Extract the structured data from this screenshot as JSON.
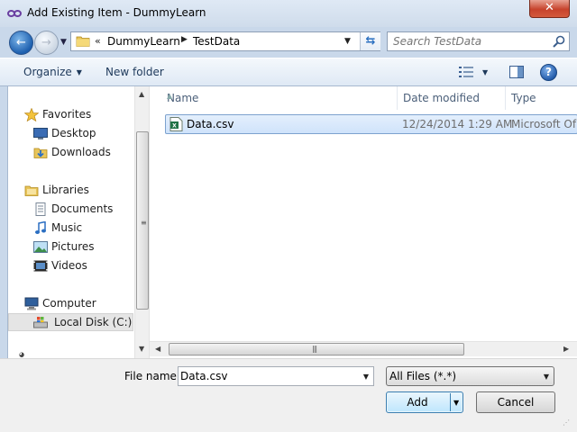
{
  "window": {
    "title": "Add Existing Item - DummyLearn",
    "close_glyph": "✕"
  },
  "navigation": {
    "back_glyph": "←",
    "forward_glyph": "→",
    "breadcrumb_overflow": "«",
    "breadcrumbs": [
      "DummyLearn",
      "TestData"
    ],
    "search_placeholder": "Search TestData"
  },
  "toolbar": {
    "organize_label": "Organize",
    "new_folder_label": "New folder",
    "help_glyph": "?"
  },
  "nav_pane": {
    "items": [
      {
        "label": "Favorites",
        "icon": "star-icon"
      },
      {
        "label": "Desktop",
        "icon": "desktop-icon"
      },
      {
        "label": "Downloads",
        "icon": "downloads-icon"
      },
      {
        "label": "Libraries",
        "icon": "libraries-icon"
      },
      {
        "label": "Documents",
        "icon": "documents-icon"
      },
      {
        "label": "Music",
        "icon": "music-icon"
      },
      {
        "label": "Pictures",
        "icon": "pictures-icon"
      },
      {
        "label": "Videos",
        "icon": "videos-icon"
      },
      {
        "label": "Computer",
        "icon": "computer-icon"
      },
      {
        "label": "Local Disk (C:)",
        "icon": "local-disk-icon",
        "selected": true
      }
    ]
  },
  "file_list": {
    "columns": [
      "Name",
      "Date modified",
      "Type"
    ],
    "rows": [
      {
        "name": "Data.csv",
        "date_modified": "12/24/2014 1:29 AM",
        "type": "Microsoft Of",
        "icon": "csv-file-icon",
        "selected": true
      }
    ]
  },
  "footer": {
    "file_name_label": "File name:",
    "file_name_value": "Data.csv",
    "file_type_value": "All Files (*.*)",
    "add_label": "Add",
    "cancel_label": "Cancel"
  },
  "colors": {
    "chrome": "#c9d8ea",
    "selection": "#cfe3fb",
    "close_button": "#c7432c",
    "link_text": "#1e395b"
  }
}
